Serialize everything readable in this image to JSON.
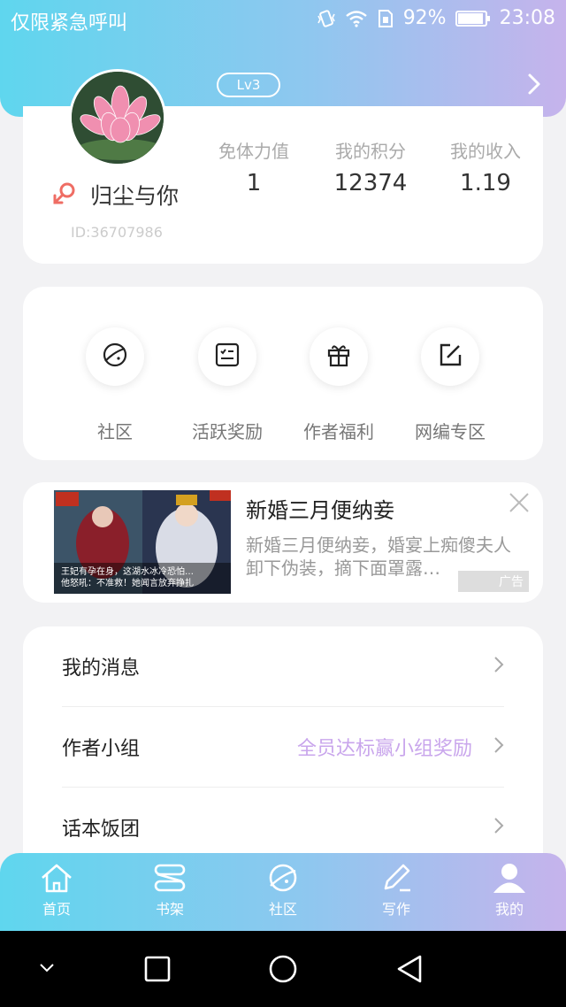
{
  "status_bar": {
    "carrier": "仅限紧急呼叫",
    "battery": "92%",
    "time": "23:08",
    "icons": [
      "vibrate-icon",
      "wifi-icon",
      "sim-icon",
      "battery-icon"
    ]
  },
  "profile": {
    "level": "Lv3",
    "username": "归尘与你",
    "user_id": "ID:36707986",
    "gender_icon": "male-symbol-icon",
    "stats": [
      {
        "label": "免体力值",
        "value": "1"
      },
      {
        "label": "我的积分",
        "value": "12374"
      },
      {
        "label": "我的收入",
        "value": "1.19"
      }
    ]
  },
  "shortcuts": [
    {
      "label": "社区",
      "icon": "planet-icon"
    },
    {
      "label": "活跃奖励",
      "icon": "checklist-icon"
    },
    {
      "label": "作者福利",
      "icon": "gift-icon"
    },
    {
      "label": "网编专区",
      "icon": "edit-icon"
    }
  ],
  "ad": {
    "title": "新婚三月便纳妾",
    "description": "新婚三月便纳妾，婚宴上痴傻夫人卸下伪装，摘下面罩露…",
    "tag": "广告",
    "image_caption_line1": "王妃有孕在身，这湖水冰冷恐怕…",
    "image_caption_line2": "他怒吼：不准救！她闻言放弃挣扎"
  },
  "menu": [
    {
      "label": "我的消息",
      "hint": ""
    },
    {
      "label": "作者小组",
      "hint": "全员达标赢小组奖励"
    },
    {
      "label": "话本饭团",
      "hint": ""
    }
  ],
  "tabs": [
    {
      "label": "首页",
      "icon": "home-icon"
    },
    {
      "label": "书架",
      "icon": "bookshelf-icon"
    },
    {
      "label": "社区",
      "icon": "planet-icon"
    },
    {
      "label": "写作",
      "icon": "pen-icon"
    },
    {
      "label": "我的",
      "icon": "person-icon"
    }
  ],
  "colors": {
    "gradient_start": "#5fd6ee",
    "gradient_end": "#c6b3ec",
    "accent_hint": "#c9a6ec"
  }
}
